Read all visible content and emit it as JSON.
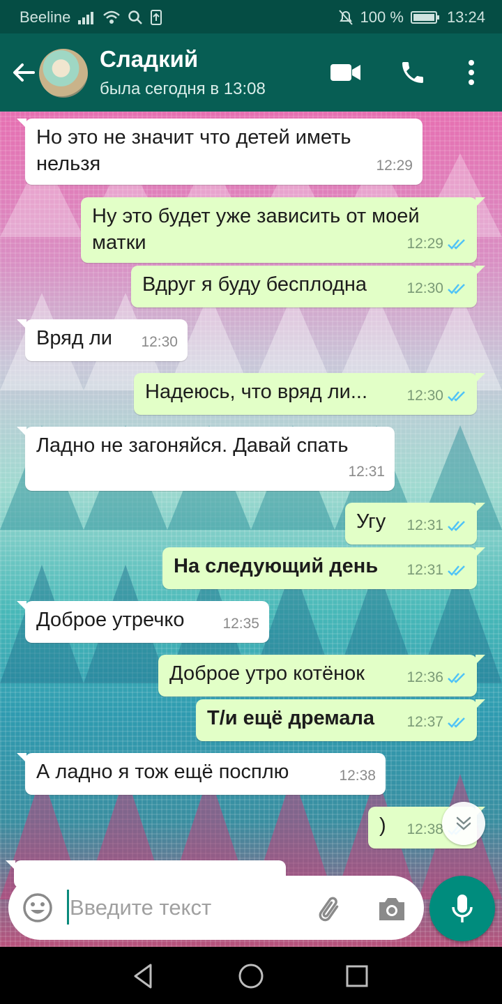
{
  "status_bar": {
    "carrier": "Beeline",
    "battery": "100 %",
    "time": "13:24"
  },
  "header": {
    "contact_name": "Сладкий",
    "last_seen": "была сегодня в 13:08",
    "icons": [
      "back-arrow-icon",
      "video-call-icon",
      "phone-call-icon",
      "more-vert-icon"
    ]
  },
  "messages": [
    {
      "dir": "in",
      "text": "Но это не значит что детей иметь нельзя",
      "time": "12:29"
    },
    {
      "dir": "out",
      "text": "Ну это будет уже зависить от моей матки",
      "time": "12:29",
      "read": true
    },
    {
      "dir": "out",
      "text": "Вдруг я буду бесплодна",
      "time": "12:30",
      "read": true
    },
    {
      "dir": "in",
      "text": "Вряд ли",
      "time": "12:30"
    },
    {
      "dir": "out",
      "text": "Надеюсь, что вряд ли...",
      "time": "12:30",
      "read": true
    },
    {
      "dir": "in",
      "text": "Ладно не загоняйся. Давай спать",
      "time": "12:31"
    },
    {
      "dir": "out",
      "text": "Угу",
      "time": "12:31",
      "read": true
    },
    {
      "dir": "out",
      "text": "На следующий день",
      "time": "12:31",
      "read": true,
      "bold": true
    },
    {
      "dir": "in",
      "text": "Доброе утречко",
      "time": "12:35"
    },
    {
      "dir": "out",
      "text": "Доброе утро котёнок",
      "time": "12:36",
      "read": true
    },
    {
      "dir": "out",
      "text": "Т/и ещё дремала",
      "time": "12:37",
      "read": true,
      "bold": true
    },
    {
      "dir": "in",
      "text": "А ладно я тож ещё посплю",
      "time": "12:38"
    },
    {
      "dir": "out",
      "text": ")",
      "time": "12:38",
      "read": true
    }
  ],
  "composer": {
    "placeholder": "Введите текст"
  },
  "colors": {
    "header": "#075E54",
    "status_bar": "#054D44",
    "outgoing_bubble": "#E2FFC7",
    "incoming_bubble": "#FFFFFF",
    "read_tick": "#4FC3F7",
    "mic_button": "#008C7D"
  }
}
